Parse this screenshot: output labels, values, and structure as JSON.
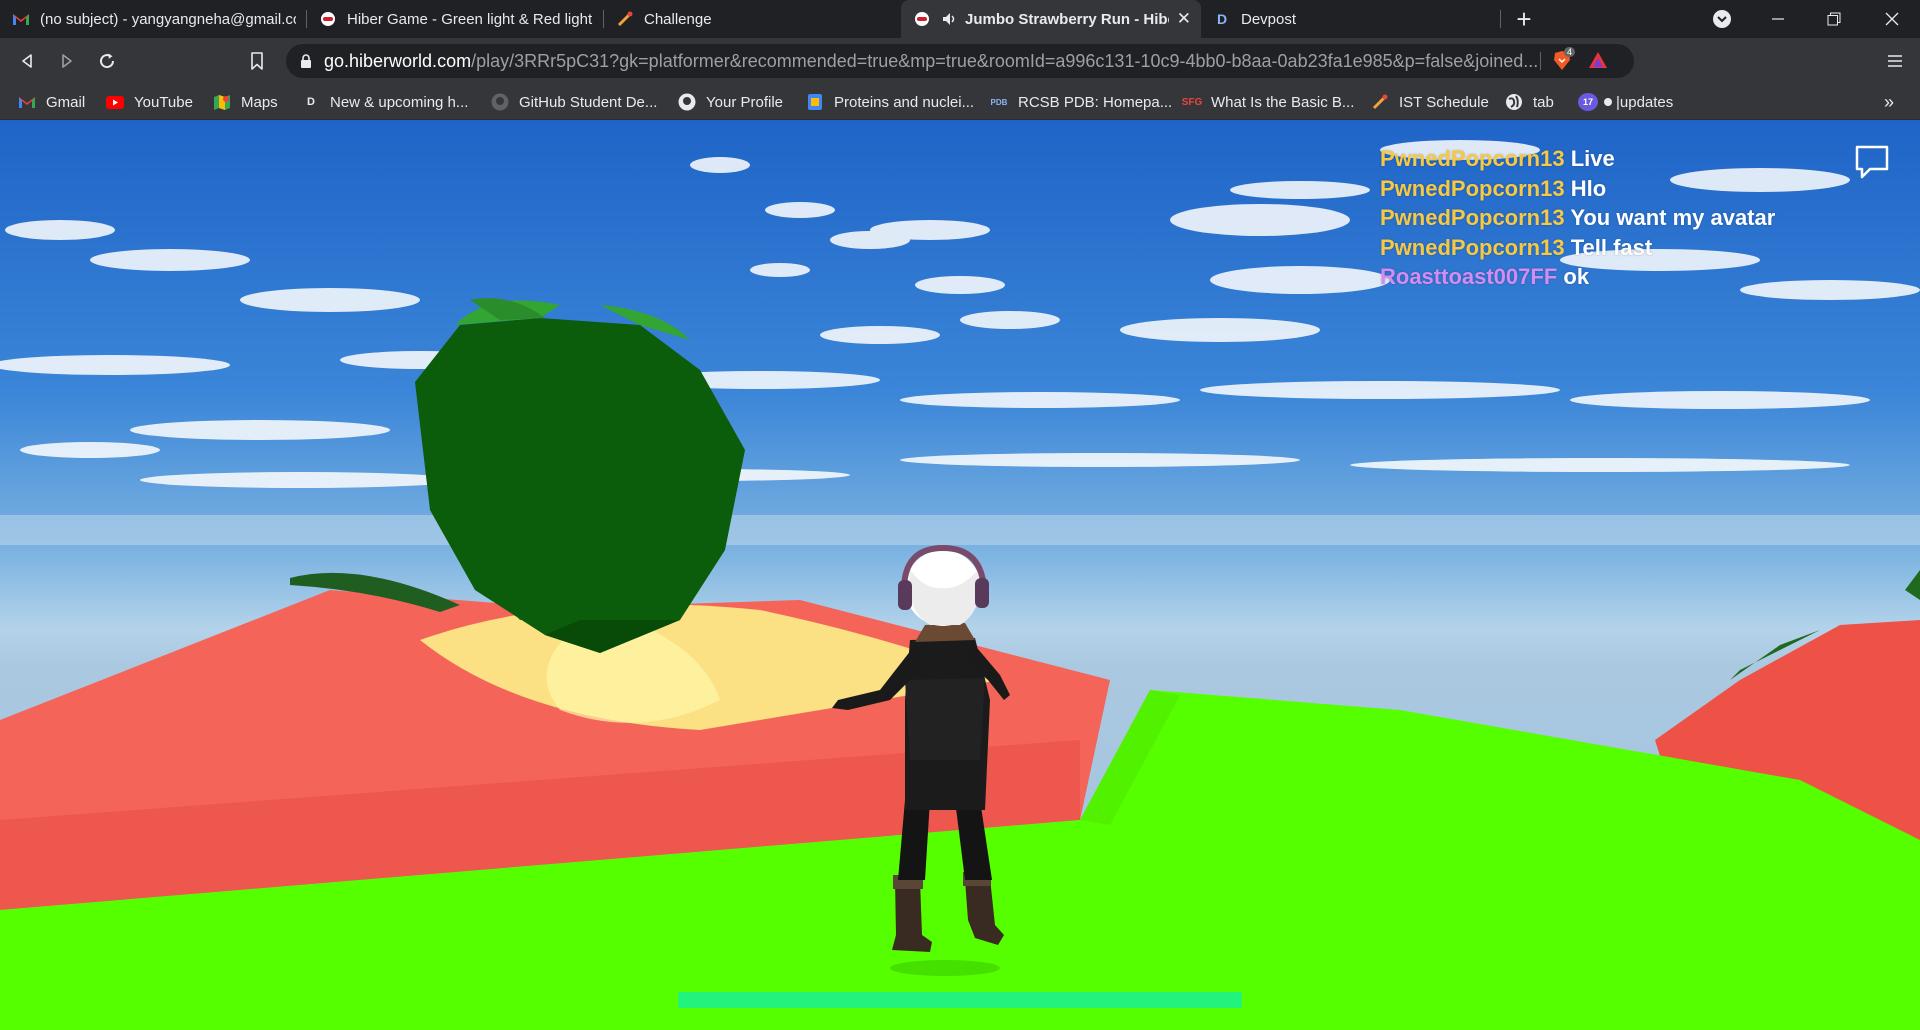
{
  "tabs": [
    {
      "title": "(no subject) - yangyangneha@gmail.com",
      "icon": "gmail-icon"
    },
    {
      "title": "Hiber Game - Green light & Red light",
      "icon": "hiber-icon"
    },
    {
      "title": "Challenge",
      "icon": "challenge-icon"
    },
    {
      "title": "Jumbo Strawberry Run - HiberWorld",
      "icon": "hiber-icon",
      "active": true
    },
    {
      "title": "Devpost",
      "icon": "devpost-icon"
    }
  ],
  "address_bar": {
    "host": "go.hiberworld.com",
    "path": "/play/3RRr5pC31?gk=platformer&recommended=true&mp=true&roomId=a996c131-10c9-4bb0-b8aa-0ab23fa1e985&p=false&joined...",
    "brave_badge": "4"
  },
  "bookmarks": [
    {
      "label": "Gmail",
      "icon": "gmail-icon"
    },
    {
      "label": "YouTube",
      "icon": "youtube-icon"
    },
    {
      "label": "Maps",
      "icon": "maps-icon"
    },
    {
      "label": "New & upcoming h...",
      "icon": "devpost-icon"
    },
    {
      "label": "GitHub Student De...",
      "icon": "github-icon"
    },
    {
      "label": "Your Profile",
      "icon": "github-icon"
    },
    {
      "label": "Proteins and nuclei...",
      "icon": "protein-icon"
    },
    {
      "label": "RCSB PDB: Homepa...",
      "icon": "pdb-icon"
    },
    {
      "label": "What Is the Basic B...",
      "icon": "sfg-icon"
    },
    {
      "label": "IST Schedule",
      "icon": "challenge-icon"
    },
    {
      "label": "tab",
      "icon": "globe-icon"
    },
    {
      "label": "|updates",
      "icon": "calendar-icon"
    }
  ],
  "bookmark_icon_text": {
    "devpost": "D",
    "pdb": "PDB",
    "sfg": "SFG",
    "calendar": "17"
  },
  "chat": [
    {
      "user": "PwnedPopcorn13",
      "message": "Live",
      "color": "#f6c944"
    },
    {
      "user": "PwnedPopcorn13",
      "message": "Hlo",
      "color": "#f6c944"
    },
    {
      "user": "PwnedPopcorn13",
      "message": "You want my avatar",
      "color": "#f6c944"
    },
    {
      "user": "PwnedPopcorn13",
      "message": "Tell fast",
      "color": "#f6c944"
    },
    {
      "user": "Roasttoast007FF",
      "message": "ok",
      "color": "#d48cf3"
    }
  ],
  "game": {
    "progress_percent": 100,
    "colors": {
      "ground": "#55ff00",
      "platform": "#f56a5a",
      "strawberry": "#0a5a0a",
      "progress": "#21f37d"
    }
  }
}
